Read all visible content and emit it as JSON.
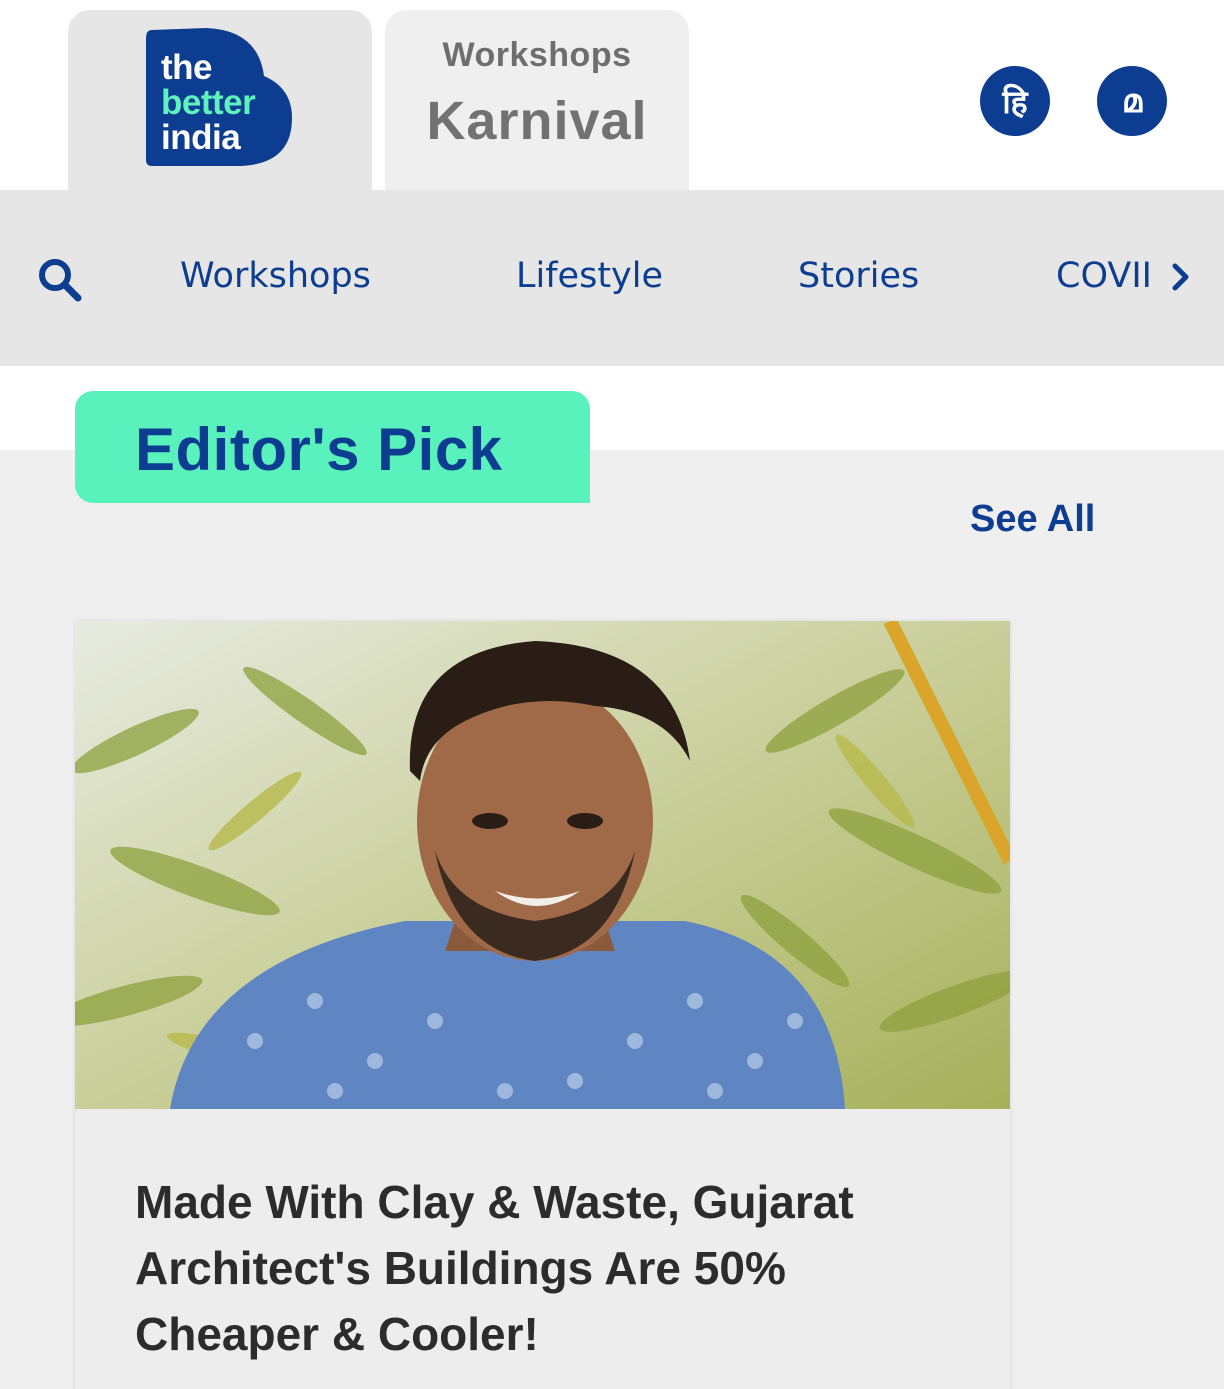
{
  "header": {
    "logo": {
      "line1": "the",
      "line2": "better",
      "line3": "india"
    },
    "karnival_tab": {
      "label": "Workshops",
      "brand": "Karnival"
    },
    "languages": [
      {
        "label": "हि"
      },
      {
        "label": "മ"
      }
    ]
  },
  "nav": {
    "items": [
      "Workshops",
      "Lifestyle",
      "Stories",
      "COVII"
    ]
  },
  "section": {
    "title": "Editor's Pick",
    "see_all": "See All"
  },
  "article": {
    "headline": "Made With Clay & Waste, Gujarat Architect's Buildings Are 50% Cheaper & Cooler!"
  },
  "colors": {
    "brand_blue": "#0d3d91",
    "accent_green": "#5af2bc"
  }
}
